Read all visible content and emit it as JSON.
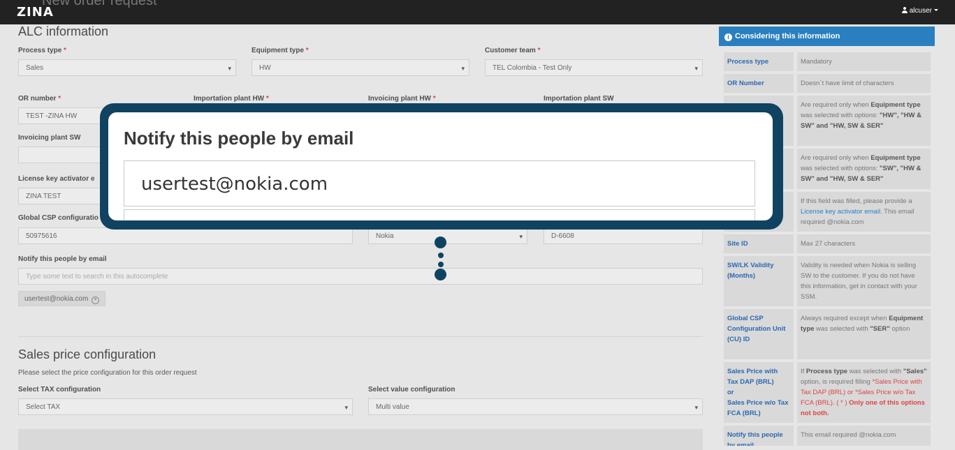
{
  "app": {
    "logo": "ZINA",
    "page_title": "New order request",
    "user": "alcuser"
  },
  "alc": {
    "heading": "ALC information",
    "process_type": {
      "label": "Process type",
      "value": "Sales"
    },
    "equipment_type": {
      "label": "Equipment type",
      "value": "HW"
    },
    "customer_team": {
      "label": "Customer team",
      "value": "TEL Colombia - Test Only"
    },
    "or_number": {
      "label": "OR number",
      "value": "TEST -ZINA HW"
    },
    "importation_plant_hw": {
      "label": "Importation plant HW"
    },
    "invoicing_plant_hw": {
      "label": "Invoicing plant HW"
    },
    "importation_plant_sw": {
      "label": "Importation plant SW"
    },
    "invoicing_plant_sw": {
      "label": "Invoicing plant SW"
    },
    "license_key": {
      "label": "License key activator e",
      "value": "ZINA TEST"
    },
    "global_csp": {
      "label": "Global CSP configuratio",
      "value": "50975616"
    },
    "vendor": {
      "value": "Nokia"
    },
    "site": {
      "value": "D-6608"
    },
    "notify": {
      "label": "Notify this people by email",
      "placeholder": "Type some text to search in this autocomplete",
      "chip": "usertest@nokia.com"
    }
  },
  "sales": {
    "heading": "Sales price configuration",
    "subtitle": "Please select the price configuration for this order request",
    "tax": {
      "label": "Select TAX configuration",
      "value": "Select TAX"
    },
    "value_config": {
      "label": "Select value configuration",
      "value": "Multi value"
    }
  },
  "side": {
    "title": "Considering this information",
    "rows": [
      {
        "k": "Process type",
        "v": "Mandatory"
      },
      {
        "k": "OR Number",
        "v": "Doesn´t have limit of characters"
      },
      {
        "k": "",
        "v_pre": "Are required only when ",
        "v_b1": "Equipment type",
        "v_mid": " was selected with options: ",
        "v_b2": "\"HW\", \"HW & SW\" and \"HW, SW & SER\""
      },
      {
        "k": "",
        "v_pre": "Are required only when ",
        "v_b1": "Equipment type",
        "v_mid": " was selected with options: ",
        "v_b2": "\"SW\", \"HW & SW\" and \"HW, SW & SER\""
      },
      {
        "k": "",
        "v_pre": "If this field was filled, please provide a ",
        "v_link": "License key activator email",
        "v_post": ". This email required @nokia.com"
      },
      {
        "k": "Site ID",
        "v": "Max 27 characters"
      },
      {
        "k": "SW/LK Validity (Months)",
        "v": "Validity is needed when Nokia is selling SW to the customer. If you do not have this information, get in contact with your SSM."
      },
      {
        "k": "Global CSP Configuration Unit (CU) ID",
        "v_pre": "Always required except when ",
        "v_b1": "Equipment type",
        "v_mid": " was selected with ",
        "v_b2": "\"SER\"",
        "v_post": " option"
      },
      {
        "k1": "Sales Price with Tax DAP (BRL)",
        "k2": "or",
        "k3": "Sales Price w/o Tax FCA (BRL)",
        "v_pre": "If ",
        "v_b1": "Process type",
        "v_mid": " was selected with ",
        "v_b2": "\"Sales\"",
        "v_post": " option, is required filling ",
        "v_r1": "*Sales Price with Tax DAP (BRL)",
        "v_or": " or ",
        "v_r2": "*Sales Price w/o Tax FCA (BRL). ( * )",
        "v_rb": "Only one of this options not both."
      },
      {
        "k": "Notify this people by email",
        "v": "This email required @nokia.com"
      }
    ]
  },
  "modal": {
    "title": "Notify this people by email",
    "email": "usertest@nokia.com"
  }
}
